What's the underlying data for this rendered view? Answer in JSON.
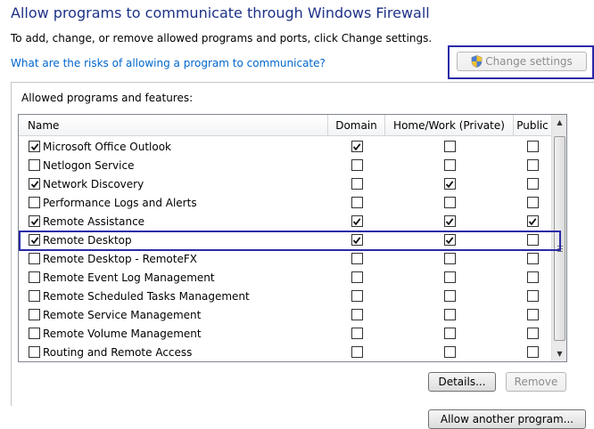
{
  "title": "Allow programs to communicate through Windows Firewall",
  "subtitle": "To add, change, or remove allowed programs and ports, click Change settings.",
  "risk_link": "What are the risks of allowing a program to communicate?",
  "change_settings_label": "Change settings",
  "group_label": "Allowed programs and features:",
  "columns": {
    "name": "Name",
    "domain": "Domain",
    "home": "Home/Work (Private)",
    "public": "Public"
  },
  "rows": [
    {
      "name": "Microsoft Office Outlook",
      "enabled": true,
      "domain": true,
      "home": false,
      "public": false
    },
    {
      "name": "Netlogon Service",
      "enabled": false,
      "domain": false,
      "home": false,
      "public": false
    },
    {
      "name": "Network Discovery",
      "enabled": true,
      "domain": false,
      "home": true,
      "public": false
    },
    {
      "name": "Performance Logs and Alerts",
      "enabled": false,
      "domain": false,
      "home": false,
      "public": false
    },
    {
      "name": "Remote Assistance",
      "enabled": true,
      "domain": true,
      "home": true,
      "public": true
    },
    {
      "name": "Remote Desktop",
      "enabled": true,
      "domain": true,
      "home": true,
      "public": false
    },
    {
      "name": "Remote Desktop - RemoteFX",
      "enabled": false,
      "domain": false,
      "home": false,
      "public": false
    },
    {
      "name": "Remote Event Log Management",
      "enabled": false,
      "domain": false,
      "home": false,
      "public": false
    },
    {
      "name": "Remote Scheduled Tasks Management",
      "enabled": false,
      "domain": false,
      "home": false,
      "public": false
    },
    {
      "name": "Remote Service Management",
      "enabled": false,
      "domain": false,
      "home": false,
      "public": false
    },
    {
      "name": "Remote Volume Management",
      "enabled": false,
      "domain": false,
      "home": false,
      "public": false
    },
    {
      "name": "Routing and Remote Access",
      "enabled": false,
      "domain": false,
      "home": false,
      "public": false
    }
  ],
  "details_label": "Details...",
  "remove_label": "Remove",
  "allow_another_label": "Allow another program...",
  "icons": {
    "shield": "uac-shield-icon",
    "check": "checkmark-icon",
    "scroll_up": "scroll-up-arrow-icon",
    "scroll_down": "scroll-down-arrow-icon"
  },
  "colors": {
    "title": "#1e3287",
    "link": "#0066cc",
    "highlight": "#2a2aa8"
  }
}
